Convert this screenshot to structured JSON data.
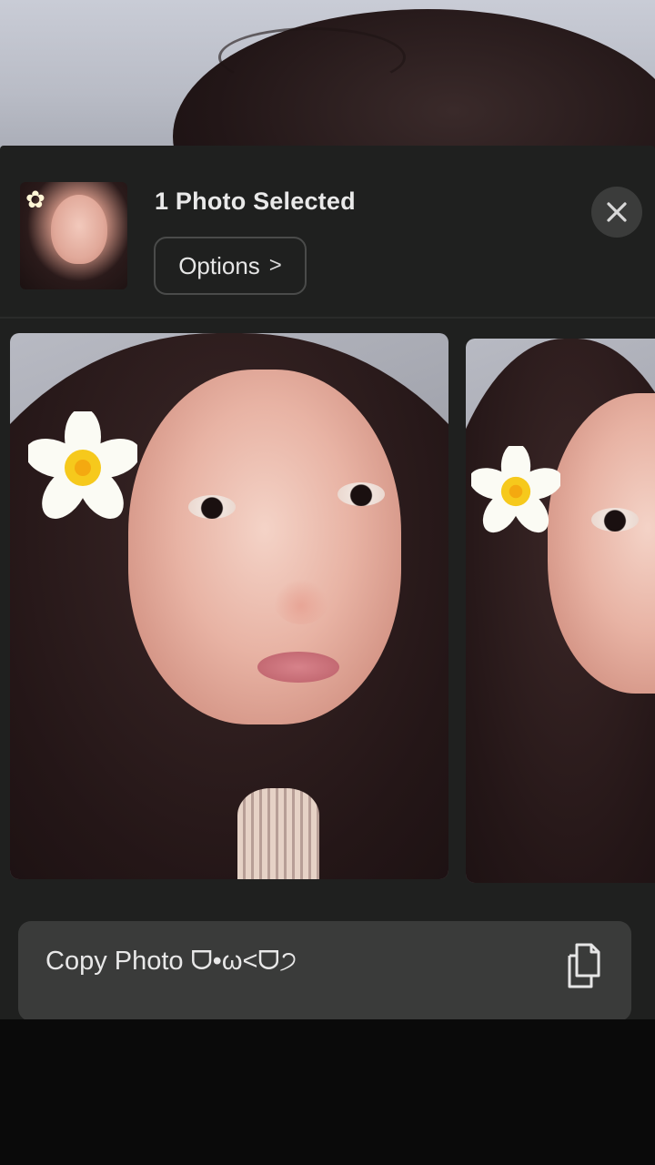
{
  "header": {
    "title": "1 Photo Selected",
    "options_label": "Options",
    "options_chevron": ">"
  },
  "icons": {
    "close": "close-icon",
    "copy": "copy-icon",
    "flower": "flower-icon",
    "chevron": "chevron-right-icon"
  },
  "actions": [
    {
      "label": "Copy Photo ᗜ•ω<ᗜ੭"
    }
  ],
  "colors": {
    "sheet_background": "#1f201f",
    "action_background": "#3a3b3a",
    "text": "#e9e9e9"
  }
}
